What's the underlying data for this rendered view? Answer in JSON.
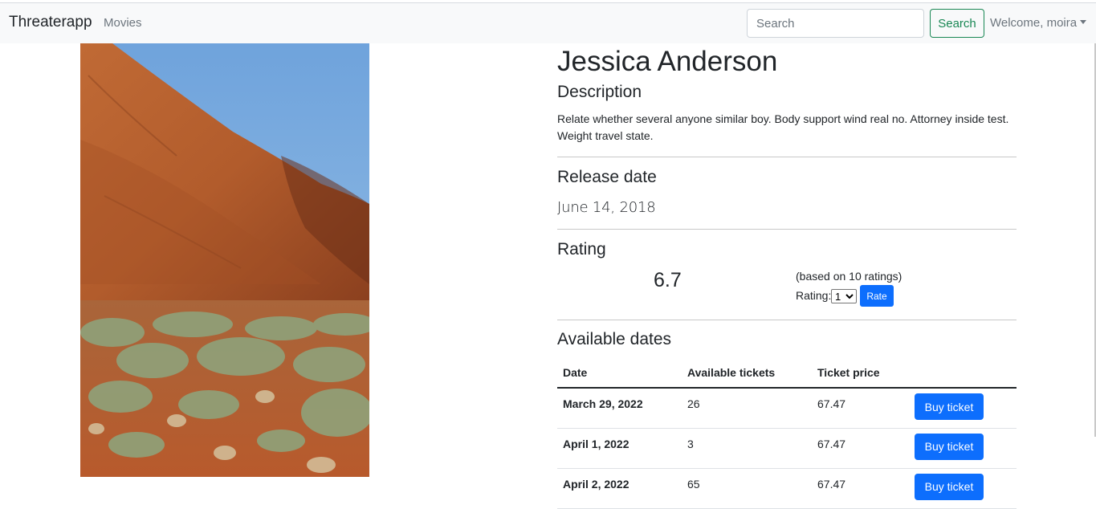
{
  "navbar": {
    "brand": "Threaterapp",
    "nav_movies": "Movies",
    "search_placeholder": "Search",
    "search_button": "Search",
    "user_menu": "Welcome, moira"
  },
  "movie": {
    "title": "Jessica Anderson",
    "description_heading": "Description",
    "description": "Relate whether several anyone similar boy. Body support wind real no. Attorney inside test. Weight travel state.",
    "release_heading": "Release date",
    "release_date": "June 14, 2018",
    "rating_heading": "Rating",
    "rating_value": "6.7",
    "rating_count": "(based on 10 ratings)",
    "rating_label": "Rating:",
    "rating_selected": "1",
    "rate_button": "Rate"
  },
  "dates": {
    "heading": "Available dates",
    "columns": [
      "Date",
      "Available tickets",
      "Ticket price",
      ""
    ],
    "rows": [
      {
        "date": "March 29, 2022",
        "tickets": "26",
        "price": "67.47",
        "action": "Buy ticket"
      },
      {
        "date": "April 1, 2022",
        "tickets": "3",
        "price": "67.47",
        "action": "Buy ticket"
      },
      {
        "date": "April 2, 2022",
        "tickets": "65",
        "price": "67.47",
        "action": "Buy ticket"
      }
    ]
  },
  "colors": {
    "primary": "#0d6efd",
    "success": "#198754",
    "navbar_bg": "#f8f9fa"
  }
}
